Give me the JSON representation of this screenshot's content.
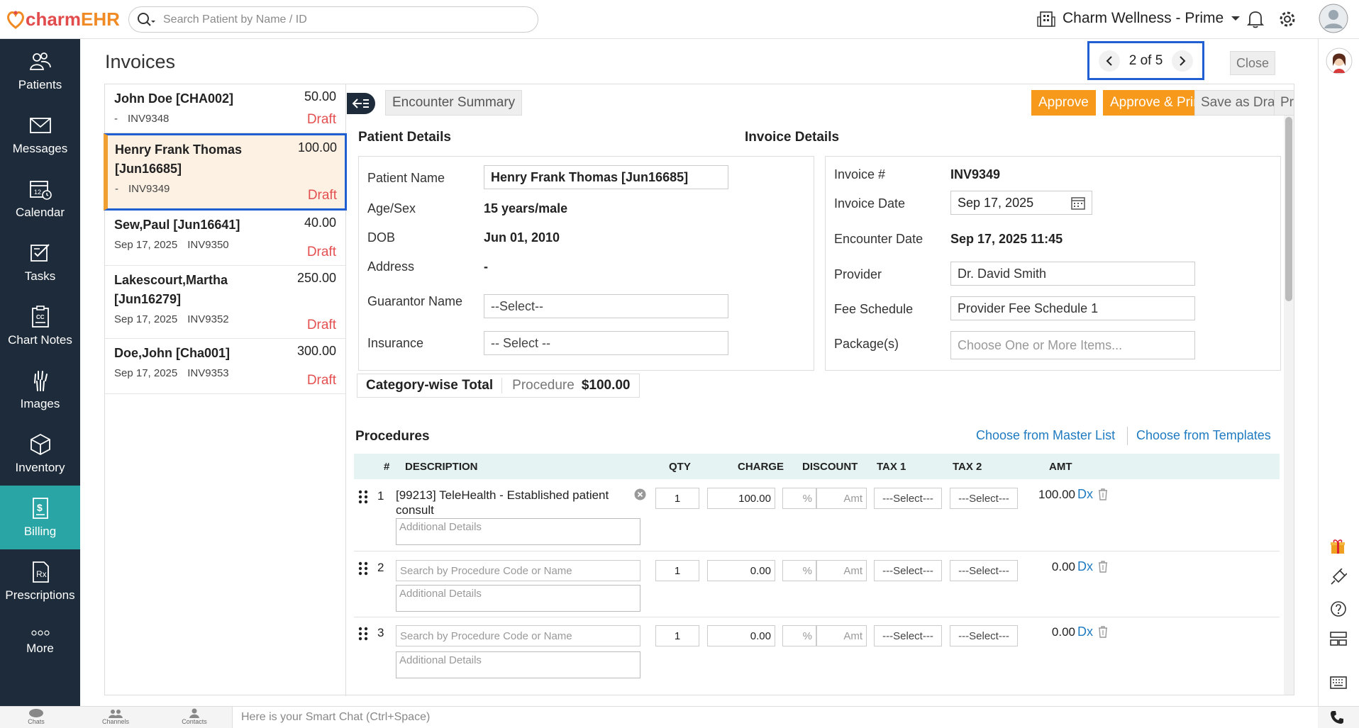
{
  "brand": {
    "logo_text_1": "charm",
    "logo_text_2": "EHR",
    "accent": "#f08a24",
    "logo_red": "#e24b4b"
  },
  "search": {
    "placeholder": "Search Patient by Name / ID"
  },
  "clinic": {
    "name": "Charm Wellness - Prime"
  },
  "sidebar": {
    "items": [
      {
        "label": "Patients",
        "icon": "patients-icon"
      },
      {
        "label": "Messages",
        "icon": "envelope-icon"
      },
      {
        "label": "Calendar",
        "icon": "calendar-icon"
      },
      {
        "label": "Tasks",
        "icon": "tasks-icon"
      },
      {
        "label": "Chart Notes",
        "icon": "clipboard-icon"
      },
      {
        "label": "Images",
        "icon": "xray-hand-icon"
      },
      {
        "label": "Inventory",
        "icon": "box-icon"
      },
      {
        "label": "Billing",
        "icon": "billing-icon",
        "active": true
      },
      {
        "label": "Prescriptions",
        "icon": "rx-icon"
      },
      {
        "label": "More",
        "icon": "more-dots-icon"
      }
    ],
    "bg": "#1d2b3a",
    "active_bg": "#2aa5a5"
  },
  "page": {
    "title": "Invoices",
    "pager_current": "2",
    "pager_of": "of",
    "pager_total": "5",
    "close_label": "Close"
  },
  "invoices": [
    {
      "name": "John Doe [CHA002]",
      "amount": "50.00",
      "date": "-",
      "inv": "INV9348",
      "status": "Draft"
    },
    {
      "name": "Henry Frank Thomas [Jun16685]",
      "amount": "100.00",
      "date": "-",
      "inv": "INV9349",
      "status": "Draft",
      "selected": true
    },
    {
      "name": "Sew,Paul [Jun16641]",
      "amount": "40.00",
      "date": "Sep 17, 2025",
      "inv": "INV9350",
      "status": "Draft"
    },
    {
      "name": "Lakescourt,Martha [Jun16279]",
      "amount": "250.00",
      "date": "Sep 17, 2025",
      "inv": "INV9352",
      "status": "Draft"
    },
    {
      "name": "Doe,John [Cha001]",
      "amount": "300.00",
      "date": "Sep 17, 2025",
      "inv": "INV9353",
      "status": "Draft"
    }
  ],
  "toolbar": {
    "encounter_summary": "Encounter Summary",
    "approve": "Approve",
    "approve_print": "Approve & Print",
    "save_draft": "Save as Draft",
    "preview": "Preview"
  },
  "patient": {
    "section": "Patient Details",
    "name_label": "Patient Name",
    "name_value": "Henry Frank Thomas [Jun16685]",
    "age_label": "Age/Sex",
    "age_value": "15 years/male",
    "dob_label": "DOB",
    "dob_value": "Jun 01, 2010",
    "address_label": "Address",
    "address_value": "-",
    "guarantor_label": "Guarantor Name",
    "guarantor_value": "--Select--",
    "insurance_label": "Insurance",
    "insurance_value": "-- Select --"
  },
  "invoice": {
    "section": "Invoice Details",
    "no_label": "Invoice #",
    "no_value": "INV9349",
    "date_label": "Invoice Date",
    "date_value": "Sep 17, 2025",
    "enc_label": "Encounter Date",
    "enc_value": "Sep 17, 2025 11:45",
    "provider_label": "Provider",
    "provider_value": "Dr. David Smith",
    "fee_label": "Fee Schedule",
    "fee_value": "Provider Fee Schedule 1",
    "pkg_label": "Package(s)",
    "pkg_placeholder": "Choose One or More Items..."
  },
  "category": {
    "label": "Category-wise Total",
    "type": "Procedure",
    "amount": "$100.00"
  },
  "procedures": {
    "section": "Procedures",
    "master_link": "Choose from Master List",
    "templates_link": "Choose from Templates",
    "headers": {
      "num": "#",
      "desc": "DESCRIPTION",
      "qty": "QTY",
      "charge": "CHARGE",
      "discount": "DISCOUNT",
      "tax1": "TAX 1",
      "tax2": "TAX 2",
      "amt": "AMT"
    },
    "rows": [
      {
        "num": "1",
        "desc": "[99213] TeleHealth - Established patient consult",
        "qty": "1",
        "charge": "100.00",
        "amount": "100.00"
      },
      {
        "num": "2",
        "desc": "",
        "qty": "1",
        "charge": "0.00",
        "amount": "0.00"
      },
      {
        "num": "3",
        "desc": "",
        "qty": "1",
        "charge": "0.00",
        "amount": "0.00"
      }
    ],
    "search_placeholder": "Search by Procedure Code or Name",
    "details_placeholder": "Additional Details",
    "pct": "%",
    "amt_ph": "Amt",
    "select": "---Select---",
    "dx": "Dx"
  },
  "bottom": {
    "chats": "Chats",
    "channels": "Channels",
    "contacts": "Contacts",
    "smart_chat_placeholder": "Here is your Smart Chat (Ctrl+Space)"
  }
}
